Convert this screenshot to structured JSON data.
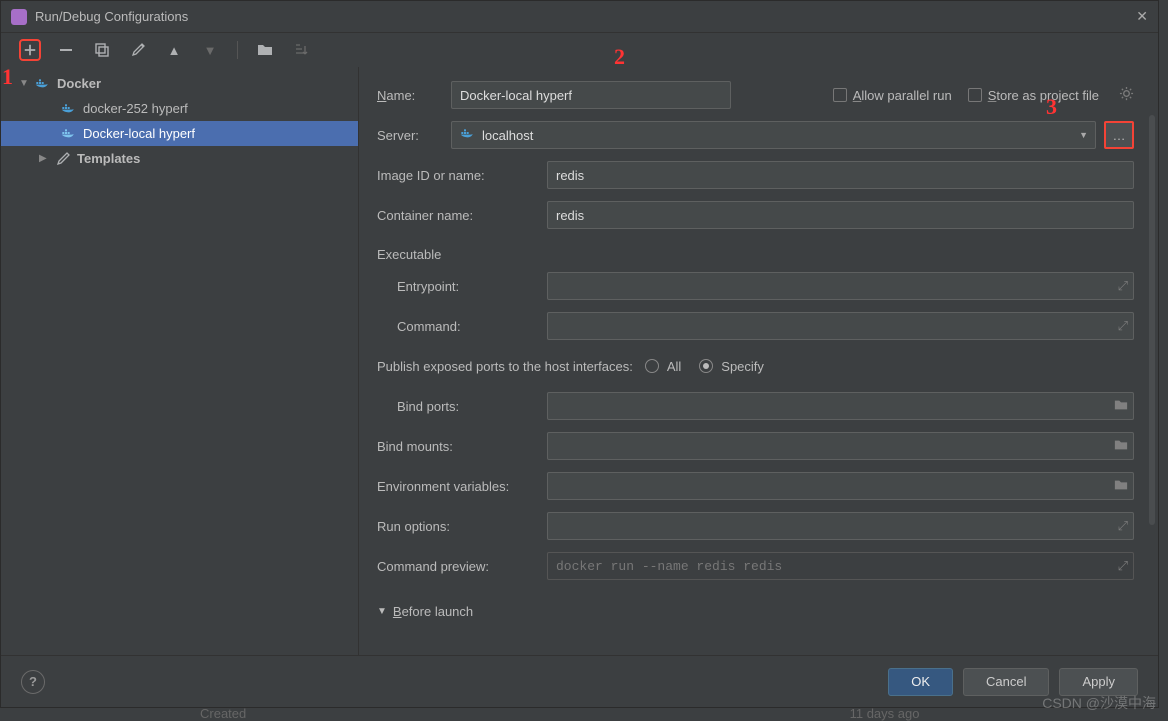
{
  "title": "Run/Debug Configurations",
  "sidebar": {
    "docker_label": "Docker",
    "items": [
      {
        "label": "docker-252 hyperf"
      },
      {
        "label": "Docker-local hyperf"
      }
    ],
    "templates_label": "Templates"
  },
  "form": {
    "name_label": "Name:",
    "name_value": "Docker-local hyperf",
    "allow_parallel": "Allow parallel run",
    "store_project": "Store as project file",
    "server_label": "Server:",
    "server_value": "localhost",
    "image_label": "Image ID or name:",
    "image_value": "redis",
    "container_label": "Container name:",
    "container_value": "redis",
    "executable_header": "Executable",
    "entrypoint_label": "Entrypoint:",
    "command_label": "Command:",
    "publish_label": "Publish exposed ports to the host interfaces:",
    "publish_all": "All",
    "publish_specify": "Specify",
    "bind_ports_label": "Bind ports:",
    "bind_mounts_label": "Bind mounts:",
    "env_label": "Environment variables:",
    "run_options_label": "Run options:",
    "cmd_preview_label": "Command preview:",
    "cmd_preview_value": "docker run --name redis redis",
    "before_launch": "Before launch"
  },
  "footer": {
    "ok": "OK",
    "cancel": "Cancel",
    "apply": "Apply"
  },
  "annotations": {
    "a1": "1",
    "a2": "2",
    "a3": "3"
  },
  "watermark": "CSDN @沙漠中海",
  "strip": {
    "created": "Created",
    "ago": "11 days ago"
  }
}
